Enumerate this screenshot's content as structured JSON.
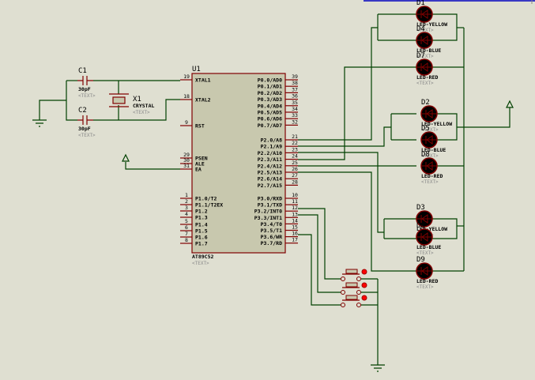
{
  "colors": {
    "background": "#dfdfd1",
    "wire": "#004000",
    "component": "#800000",
    "chip_fill": "#c8c8ae",
    "led_fill": "#000000",
    "pin_dot": "#ff0000",
    "frame": "#0000c0"
  },
  "chip": {
    "ref": "U1",
    "part": "AT89C52",
    "text": "<TEXT>",
    "left_pins": [
      {
        "num": "19",
        "name": "XTAL1"
      },
      {
        "num": "18",
        "name": "XTAL2"
      },
      {
        "num": "9",
        "name": "RST"
      },
      {
        "num": "29",
        "name": "PSEN"
      },
      {
        "num": "30",
        "name": "ALE"
      },
      {
        "num": "31",
        "name": "EA"
      },
      {
        "num": "1",
        "name": "P1.0/T2"
      },
      {
        "num": "2",
        "name": "P1.1/T2EX"
      },
      {
        "num": "3",
        "name": "P1.2"
      },
      {
        "num": "4",
        "name": "P1.3"
      },
      {
        "num": "5",
        "name": "P1.4"
      },
      {
        "num": "6",
        "name": "P1.5"
      },
      {
        "num": "7",
        "name": "P1.6"
      },
      {
        "num": "8",
        "name": "P1.7"
      }
    ],
    "right_pins": [
      {
        "num": "39",
        "name": "P0.0/AD0"
      },
      {
        "num": "38",
        "name": "P0.1/AD1"
      },
      {
        "num": "37",
        "name": "P0.2/AD2"
      },
      {
        "num": "36",
        "name": "P0.3/AD3"
      },
      {
        "num": "35",
        "name": "P0.4/AD4"
      },
      {
        "num": "34",
        "name": "P0.5/AD5"
      },
      {
        "num": "33",
        "name": "P0.6/AD6"
      },
      {
        "num": "32",
        "name": "P0.7/AD7"
      },
      {
        "num": "21",
        "name": "P2.0/A8"
      },
      {
        "num": "22",
        "name": "P2.1/A9"
      },
      {
        "num": "23",
        "name": "P2.2/A10"
      },
      {
        "num": "24",
        "name": "P2.3/A11"
      },
      {
        "num": "25",
        "name": "P2.4/A12"
      },
      {
        "num": "26",
        "name": "P2.5/A13"
      },
      {
        "num": "27",
        "name": "P2.6/A14"
      },
      {
        "num": "28",
        "name": "P2.7/A15"
      },
      {
        "num": "10",
        "name": "P3.0/RXD"
      },
      {
        "num": "11",
        "name": "P3.1/TXD"
      },
      {
        "num": "12",
        "name": "P3.2/INT0"
      },
      {
        "num": "13",
        "name": "P3.3/INT1"
      },
      {
        "num": "14",
        "name": "P3.4/T0"
      },
      {
        "num": "15",
        "name": "P3.5/T1"
      },
      {
        "num": "16",
        "name": "P3.6/WR"
      },
      {
        "num": "17",
        "name": "P3.7/RD"
      }
    ]
  },
  "caps": [
    {
      "ref": "C1",
      "value": "30pF",
      "text": "<TEXT>"
    },
    {
      "ref": "C2",
      "value": "30pF",
      "text": "<TEXT>"
    }
  ],
  "crystal": {
    "ref": "X1",
    "value": "CRYSTAL",
    "text": "<TEXT>"
  },
  "leds": [
    {
      "ref": "D1",
      "value": "LED-YELLOW",
      "text": "<TEXT>"
    },
    {
      "ref": "D4",
      "value": "LED-BLUE",
      "text": "<TEXT>"
    },
    {
      "ref": "D7",
      "value": "LED-RED",
      "text": "<TEXT>"
    },
    {
      "ref": "D2",
      "value": "LED-YELLOW",
      "text": "<TEXT>"
    },
    {
      "ref": "D5",
      "value": "LED-BLUE",
      "text": "<TEXT>"
    },
    {
      "ref": "D8",
      "value": "LED-RED",
      "text": "<TEXT>"
    },
    {
      "ref": "D3",
      "value": "LED-YELLOW",
      "text": "<TEXT>"
    },
    {
      "ref": "D6",
      "value": "LED-BLUE",
      "text": "<TEXT>"
    },
    {
      "ref": "D9",
      "value": "LED-RED",
      "text": "<TEXT>"
    }
  ],
  "buttons": [
    {
      "name": "button-1"
    },
    {
      "name": "button-2"
    },
    {
      "name": "button-3"
    }
  ]
}
